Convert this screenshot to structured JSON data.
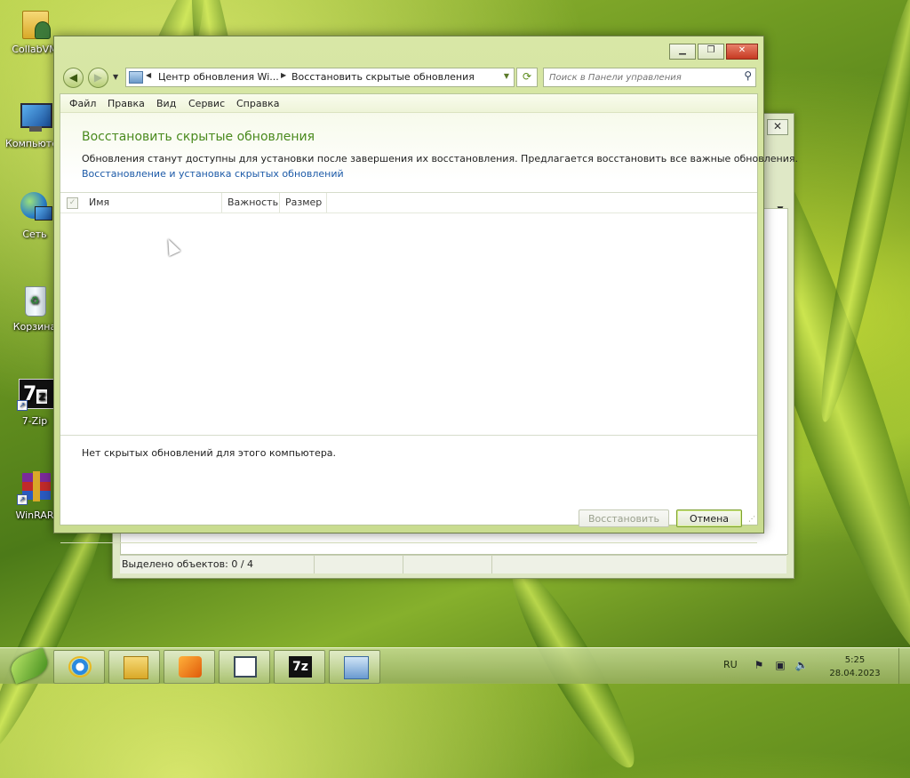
{
  "desktop": {
    "icons": [
      {
        "label": "CollabVM"
      },
      {
        "label": "Компьютер"
      },
      {
        "label": "Сеть"
      },
      {
        "label": "Корзина"
      },
      {
        "label": "7-Zip"
      },
      {
        "label": "WinRAR"
      }
    ]
  },
  "bg_window": {
    "status_text": "Выделено объектов: 0 / 4"
  },
  "window": {
    "address": {
      "crumb1": "Центр обновления Wi...",
      "crumb2": "Восстановить скрытые обновления"
    },
    "search_placeholder": "Поиск в Панели управления",
    "menu": [
      "Файл",
      "Правка",
      "Вид",
      "Сервис",
      "Справка"
    ],
    "page_title": "Восстановить скрытые обновления",
    "description": "Обновления станут доступны для установки после завершения их восстановления. Предлагается восстановить все важные обновления.",
    "link_text": "Восстановление и установка скрытых обновлений",
    "columns": [
      "Имя",
      "Важность",
      "Размер"
    ],
    "empty_message": "Нет скрытых обновлений для этого компьютера.",
    "restore_button": "Восстановить",
    "cancel_button": "Отмена"
  },
  "taskbar": {
    "language": "RU",
    "time": "5:25",
    "date": "28.04.2023"
  },
  "colors": {
    "title_green": "#4a8a1e",
    "link_blue": "#1c5aa8"
  }
}
